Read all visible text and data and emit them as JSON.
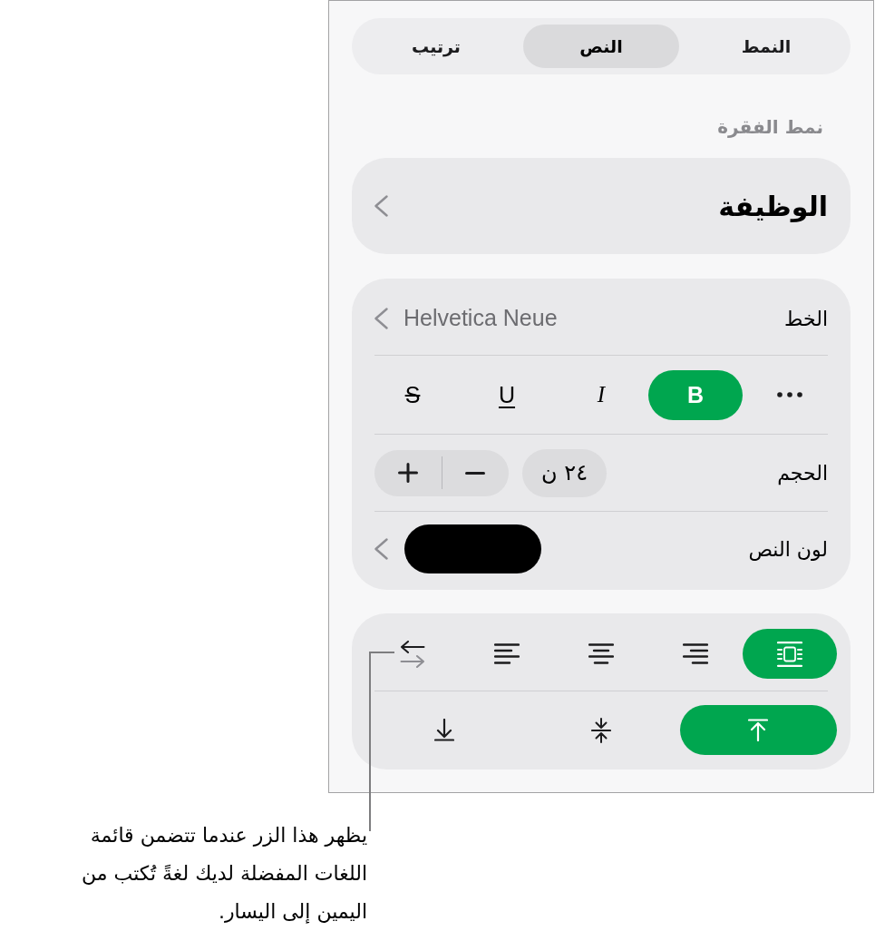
{
  "tabs": [
    {
      "label": "النمط",
      "selected": false
    },
    {
      "label": "النص",
      "selected": true
    },
    {
      "label": "ترتيب",
      "selected": false
    }
  ],
  "paragraph_style": {
    "heading": "نمط الفقرة",
    "value": "الوظيفة"
  },
  "font": {
    "label": "الخط",
    "value": "Helvetica Neue"
  },
  "text_styles": [
    {
      "kind": "more",
      "selected": false
    },
    {
      "kind": "bold",
      "label": "B",
      "selected": true
    },
    {
      "kind": "italic",
      "label": "I",
      "selected": false
    },
    {
      "kind": "underline",
      "label": "U",
      "selected": false
    },
    {
      "kind": "strikethrough",
      "label": "S",
      "selected": false
    }
  ],
  "font_size": {
    "label": "الحجم",
    "value": "٢٤ ن"
  },
  "text_color": {
    "label": "لون النص",
    "color": "#000000"
  },
  "horizontal_alignment": [
    {
      "kind": "justify",
      "selected": true
    },
    {
      "kind": "right",
      "selected": false
    },
    {
      "kind": "center",
      "selected": false
    },
    {
      "kind": "left",
      "selected": false
    },
    {
      "kind": "direction",
      "selected": false
    }
  ],
  "vertical_alignment": [
    {
      "kind": "top",
      "selected": true
    },
    {
      "kind": "middle",
      "selected": false
    },
    {
      "kind": "bottom",
      "selected": false
    }
  ],
  "callout": "يظهر هذا الزر عندما تتضمن قائمة اللغات المفضلة لديك لغةً تُكتب من اليمين إلى اليسار."
}
